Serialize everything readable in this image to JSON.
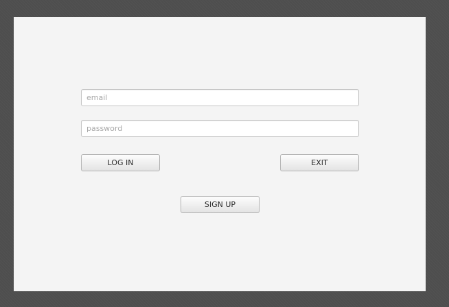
{
  "login_form": {
    "email": {
      "placeholder": "email",
      "value": ""
    },
    "password": {
      "placeholder": "password",
      "value": ""
    },
    "login_label": "LOG IN",
    "exit_label": "EXIT",
    "signup_label": "SIGN UP"
  },
  "colors": {
    "window_background": "#f4f4f4",
    "desktop_background": "#4e4e4e",
    "field_border": "#c3c3c3",
    "placeholder_text": "#a8a8a8"
  }
}
